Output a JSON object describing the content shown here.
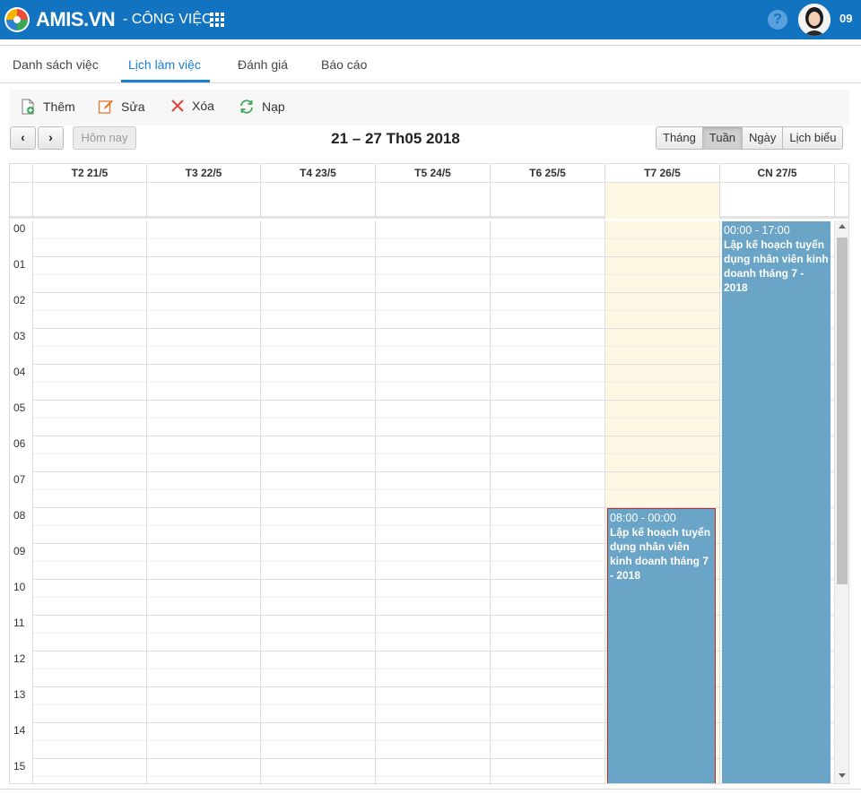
{
  "app": {
    "brand": "AMIS.VN",
    "module": "- CÔNG VIỆC",
    "user": "09",
    "help_icon": "?"
  },
  "tabs": [
    {
      "label": "Danh sách việc",
      "active": false
    },
    {
      "label": "Lịch làm việc",
      "active": true
    },
    {
      "label": "Đánh giá",
      "active": false
    },
    {
      "label": "Báo cáo",
      "active": false
    }
  ],
  "toolbar": {
    "add_label": "Thêm",
    "edit_label": "Sửa",
    "delete_label": "Xóa",
    "reload_label": "Nạp"
  },
  "calendar": {
    "prev_label": "‹",
    "next_label": "›",
    "today_label": "Hôm nay",
    "title": "21 – 27 Th05 2018",
    "views": [
      {
        "label": "Tháng",
        "active": false
      },
      {
        "label": "Tuần",
        "active": true
      },
      {
        "label": "Ngày",
        "active": false
      },
      {
        "label": "Lịch biểu",
        "active": false
      }
    ],
    "days": [
      "T2 21/5",
      "T3 22/5",
      "T4 23/5",
      "T5 24/5",
      "T6 25/5",
      "T7 26/5",
      "CN 27/5"
    ],
    "highlighted_day": "T7 26/5",
    "hours": [
      "00",
      "01",
      "02",
      "03",
      "04",
      "05",
      "06",
      "07",
      "08",
      "09",
      "10",
      "11",
      "12",
      "13",
      "14",
      "15"
    ],
    "events": [
      {
        "day": "T7 26/5",
        "time": "08:00 - 00:00",
        "title": "Lập kế hoạch tuyển dụng nhân viên kinh doanh tháng 7 - 2018",
        "selected": true
      },
      {
        "day": "CN 27/5",
        "time": "00:00 - 17:00",
        "title": "Lập kế hoạch tuyển dụng nhân viên kinh doanh tháng 7 - 2018",
        "selected": false
      }
    ]
  },
  "colors": {
    "topbar": "#1273c0",
    "accent": "#1a7fd0",
    "event": "#6aa4c6",
    "today_highlight": "#fcf8e3",
    "selected_border": "#c0292b"
  }
}
